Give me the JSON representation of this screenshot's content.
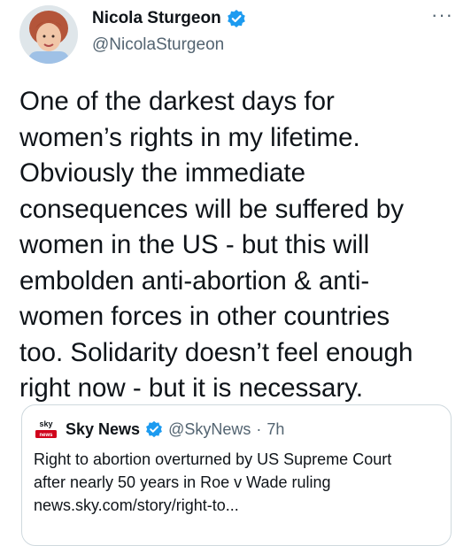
{
  "author": {
    "name": "Nicola Sturgeon",
    "handle": "@NicolaSturgeon",
    "verified": true
  },
  "more_label": "···",
  "tweet": {
    "lines": [
      "One of the darkest days for",
      "women’s rights in my lifetime.",
      "Obviously the immediate",
      "consequences will be suffered by",
      "women in the US - but this will",
      "embolden anti-abortion & anti-",
      "women forces in other countries",
      "too. Solidarity doesn’t feel enough",
      "right now - but it is necessary."
    ]
  },
  "quote": {
    "logo_text": "sky news",
    "name": "Sky News",
    "handle": "@SkyNews",
    "separator": "·",
    "time": "7h",
    "lines": [
      "Right to abortion overturned by US Supreme Court",
      "after nearly 50 years in Roe v Wade ruling",
      "news.sky.com/story/right-to..."
    ]
  },
  "colors": {
    "verified_blue": "#1d9bf0",
    "secondary_text": "#536471",
    "border": "#cfd9de"
  }
}
